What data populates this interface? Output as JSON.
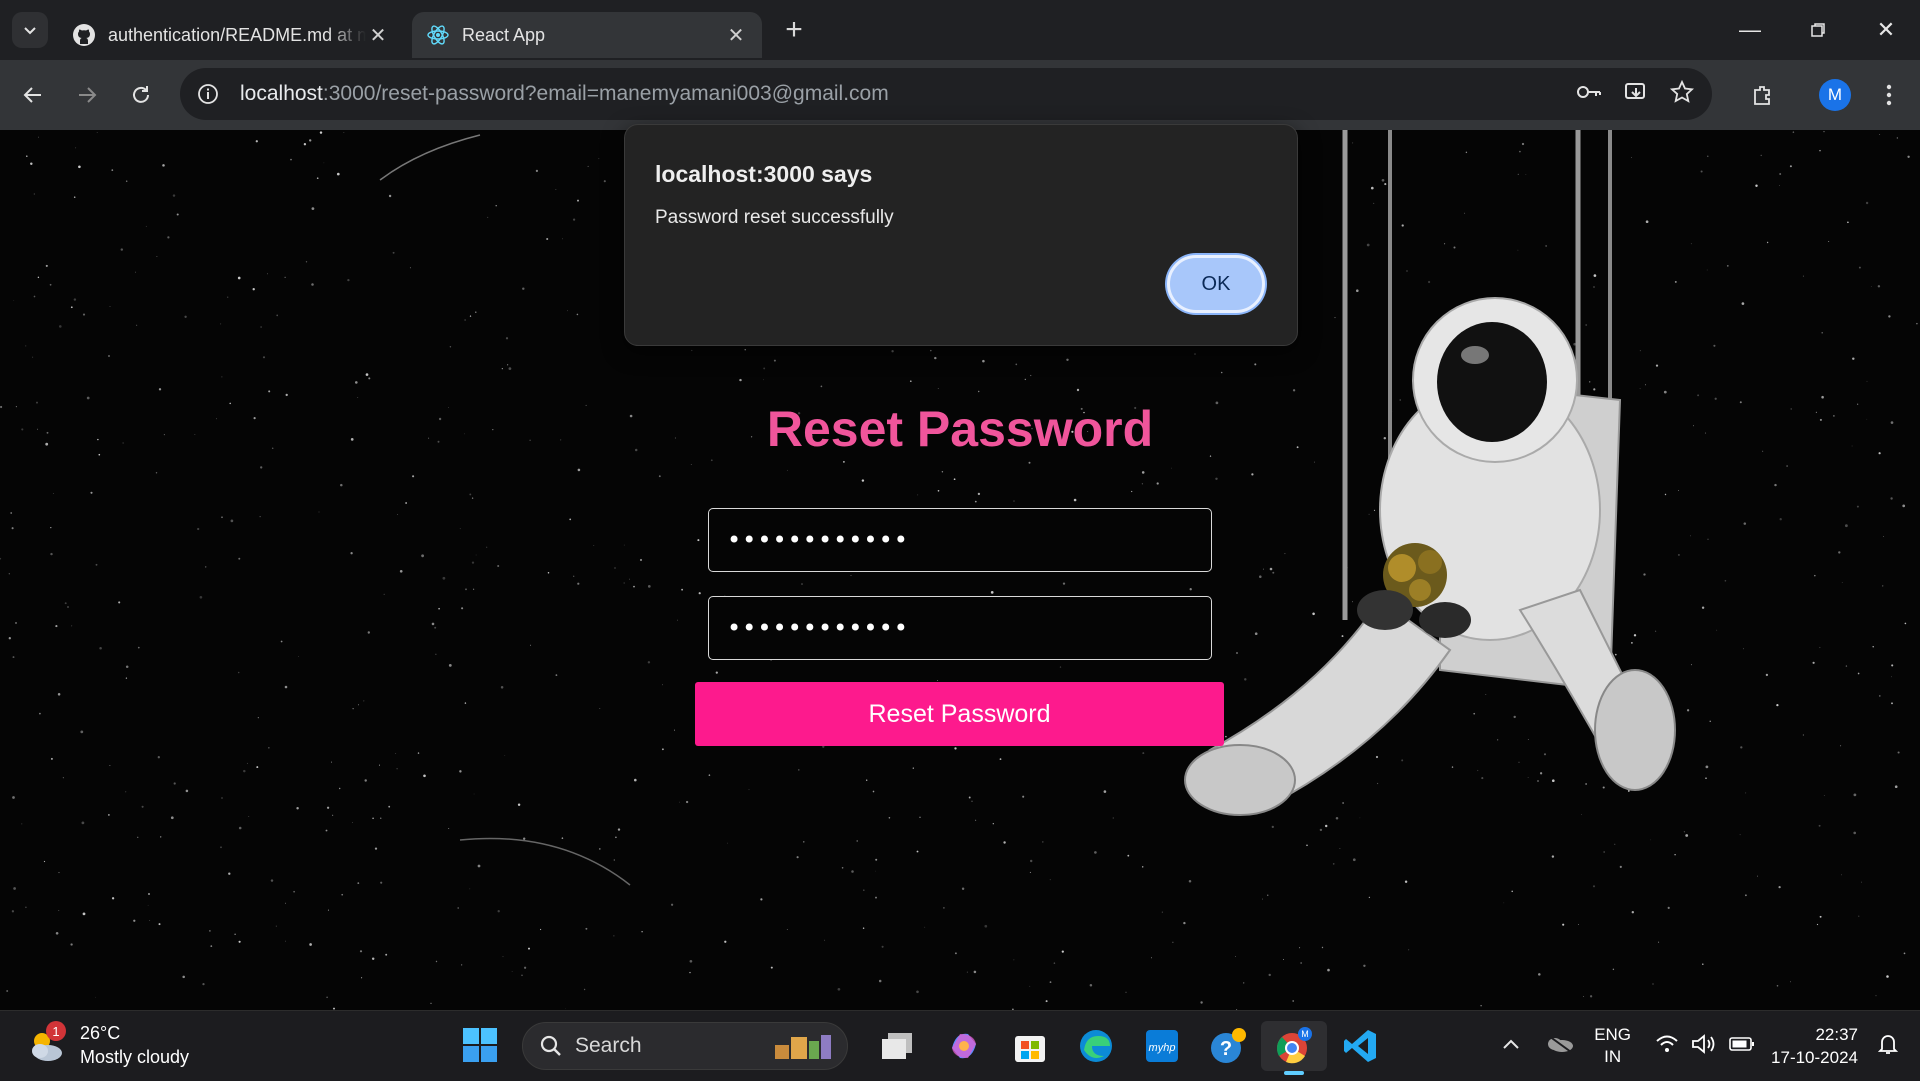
{
  "browser": {
    "tabs": [
      {
        "title": "authentication/README.md at main",
        "favicon": "github-icon",
        "active": false
      },
      {
        "title": "React App",
        "favicon": "react-icon",
        "active": true
      }
    ],
    "url_host": "localhost",
    "url_rest": ":3000/reset-password?email=manemyamani003@gmail.com",
    "profile_initial": "M"
  },
  "page": {
    "heading": "Reset Password",
    "password_value": "••••••••••••",
    "confirm_password_value": "••••••••••••",
    "submit_label": "Reset Password",
    "colors": {
      "heading": "#f0559b",
      "button": "#fd1a8d",
      "background": "#050505"
    }
  },
  "dialog": {
    "title": "localhost:3000 says",
    "message": "Password reset successfully",
    "ok_label": "OK"
  },
  "taskbar": {
    "weather_temp": "26°C",
    "weather_desc": "Mostly cloudy",
    "weather_badge": "1",
    "search_label": "Search",
    "lang_line1": "ENG",
    "lang_line2": "IN",
    "time": "22:37",
    "date": "17-10-2024"
  }
}
